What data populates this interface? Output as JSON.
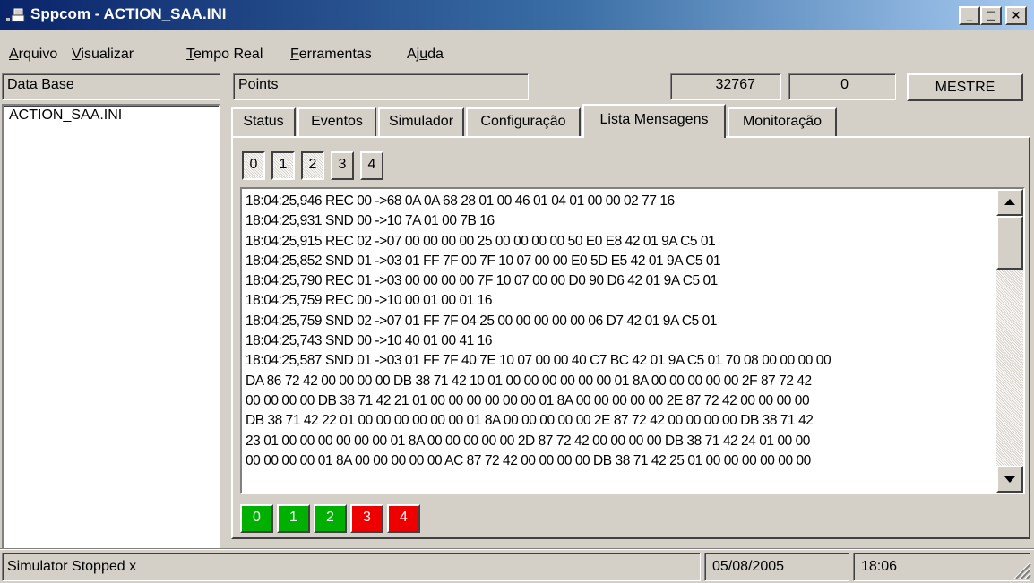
{
  "window": {
    "title": "Sppcom - ACTION_SAA.INI",
    "controls": {
      "minimize": "_",
      "maximize": "□",
      "close": "×"
    }
  },
  "menu": [
    {
      "label": "Arquivo",
      "accel": "A"
    },
    {
      "label": "Visualizar",
      "accel": "V"
    },
    {
      "label": "Tempo Real",
      "accel": "T"
    },
    {
      "label": "Ferramentas",
      "accel": "F"
    },
    {
      "label": "Ajuda",
      "accel": "u"
    }
  ],
  "toolbar": {
    "database_label": "Data Base",
    "points_label": "Points",
    "counter1": "32767",
    "counter2": "0",
    "mode_button": "MESTRE"
  },
  "database_list": [
    "ACTION_SAA.INI"
  ],
  "tabs": [
    {
      "label": "Status",
      "active": false
    },
    {
      "label": "Eventos",
      "active": false
    },
    {
      "label": "Simulador",
      "active": false
    },
    {
      "label": "Configuração",
      "active": false
    },
    {
      "label": "Lista Mensagens",
      "active": true
    },
    {
      "label": "Monitoração",
      "active": false
    }
  ],
  "channel_buttons": [
    {
      "label": "0",
      "pressed": true
    },
    {
      "label": "1",
      "pressed": true
    },
    {
      "label": "2",
      "pressed": true
    },
    {
      "label": "3",
      "pressed": false
    },
    {
      "label": "4",
      "pressed": false
    }
  ],
  "log_lines": [
    "18:04:25,946 REC 00 ->68 0A 0A 68 28 01 00 46 01 04 01 00 00 02 77 16",
    "18:04:25,931 SND 00 ->10 7A 01 00 7B 16",
    "18:04:25,915 REC 02 ->07 00 00 00 00 25 00 00 00 00 50 E0 E8 42 01 9A C5 01",
    "18:04:25,852 SND 01 ->03 01 FF 7F 00 7F 10 07 00 00 E0 5D E5 42 01 9A C5 01",
    "18:04:25,790 REC 01 ->03 00 00 00 00 7F 10 07 00 00 D0 90 D6 42 01 9A C5 01",
    "18:04:25,759 REC 00 ->10 00 01 00 01 16",
    "18:04:25,759 SND 02 ->07 01 FF 7F 04 25 00 00 00 00 00 06 D7 42 01 9A C5 01",
    "18:04:25,743 SND 00 ->10 40 01 00 41 16",
    "18:04:25,587 SND 01 ->03 01 FF 7F 40 7E 10 07 00 00 40 C7 BC 42 01 9A C5 01 70 08 00 00 00 00",
    "DA 86 72 42 00 00 00 00 DB 38 71 42 10 01 00 00 00 00 00 00 01 8A 00 00 00 00 00 2F 87 72 42",
    "00 00 00 00 DB 38 71 42 21 01 00 00 00 00 00 00 01 8A 00 00 00 00 00 2E 87 72 42 00 00 00 00",
    "DB 38 71 42 22 01 00 00 00 00 00 00 01 8A 00 00 00 00 00 2E 87 72 42 00 00 00 00 DB 38 71 42",
    "23 01 00 00 00 00 00 00 01 8A 00 00 00 00 00 2D 87 72 42 00 00 00 00 DB 38 71 42 24 01 00 00",
    "00 00 00 00 01 8A 00 00 00 00 00 AC 87 72 42 00 00 00 00 DB 38 71 42 25 01 00 00 00 00 00 00"
  ],
  "channel_status": [
    {
      "label": "0",
      "color": "#00b000"
    },
    {
      "label": "1",
      "color": "#00b000"
    },
    {
      "label": "2",
      "color": "#00b000"
    },
    {
      "label": "3",
      "color": "#ee0000"
    },
    {
      "label": "4",
      "color": "#ee0000"
    }
  ],
  "statusbar": {
    "message": "Simulator Stopped x",
    "date": "05/08/2005",
    "time": "18:06"
  }
}
